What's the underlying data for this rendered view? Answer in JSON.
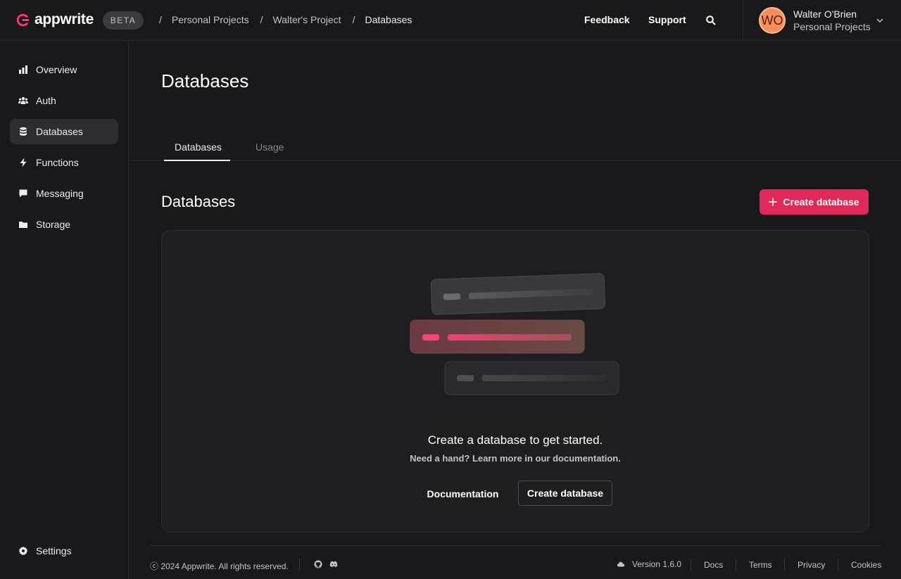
{
  "header": {
    "brand": "appwrite",
    "badge": "BETA",
    "breadcrumbs": [
      "Personal Projects",
      "Walter's Project",
      "Databases"
    ],
    "feedback_label": "Feedback",
    "support_label": "Support",
    "user": {
      "initials": "WO",
      "name": "Walter O'Brien",
      "org": "Personal Projects"
    }
  },
  "sidebar": {
    "items": [
      {
        "label": "Overview",
        "icon": "chart-icon"
      },
      {
        "label": "Auth",
        "icon": "users-icon"
      },
      {
        "label": "Databases",
        "icon": "database-icon",
        "active": true
      },
      {
        "label": "Functions",
        "icon": "lightning-icon"
      },
      {
        "label": "Messaging",
        "icon": "chat-icon"
      },
      {
        "label": "Storage",
        "icon": "folder-icon"
      }
    ],
    "settings_label": "Settings"
  },
  "main": {
    "title": "Databases",
    "tabs": [
      {
        "label": "Databases",
        "active": true
      },
      {
        "label": "Usage",
        "active": false
      }
    ],
    "section_title": "Databases",
    "create_button_label": "Create database",
    "empty": {
      "title": "Create a database to get started.",
      "subtitle": "Need a hand? Learn more in our documentation.",
      "docs_button": "Documentation",
      "create_button": "Create database"
    }
  },
  "footer": {
    "copyright": "ⓒ 2024 Appwrite. All rights reserved.",
    "version": "Version 1.6.0",
    "links": [
      "Docs",
      "Terms",
      "Privacy",
      "Cookies"
    ]
  },
  "colors": {
    "accent": "#e1285a",
    "background": "#19191c",
    "card": "#1e1e21",
    "avatar": "#fd8e5a"
  }
}
